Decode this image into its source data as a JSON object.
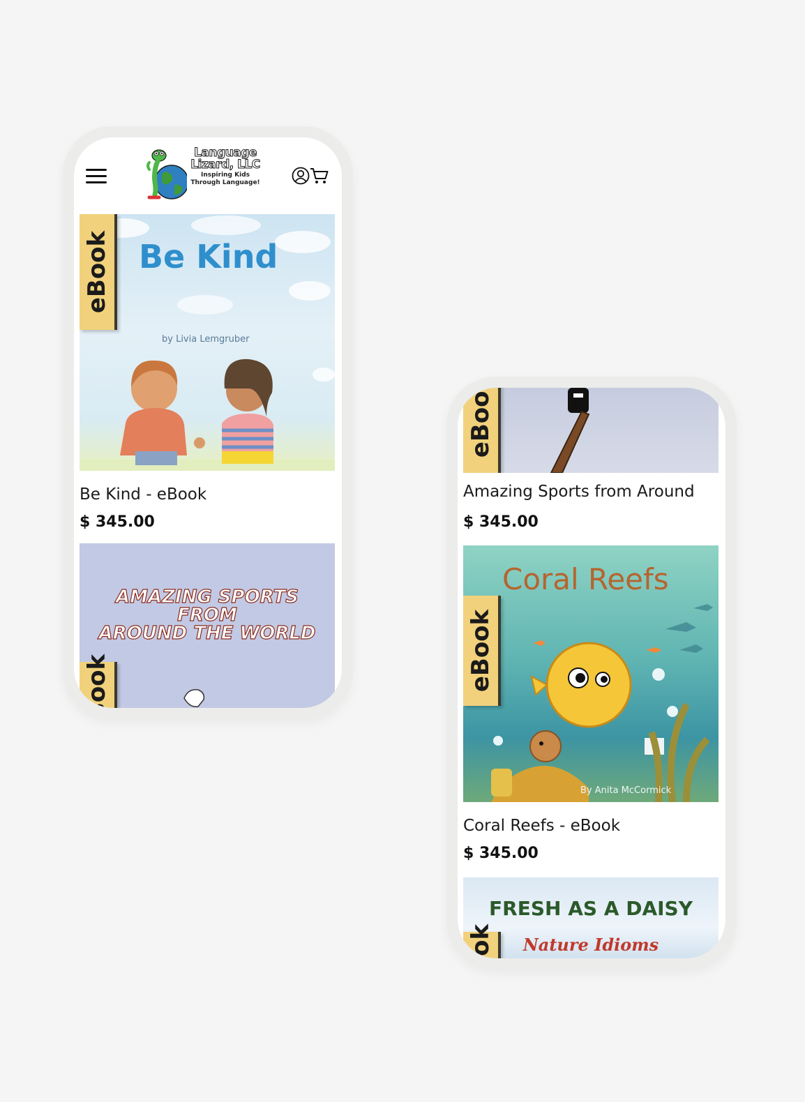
{
  "colors": {
    "background": "#f5f5f5",
    "ebook_tab": "#f1d17c",
    "be_kind_title": "#2f8fcd",
    "coral_title": "#b5652f",
    "daisy_title": "#2b5a2a",
    "daisy_subtitle": "#c0392b"
  },
  "header": {
    "menu_icon": "hamburger-icon",
    "logo": {
      "line1": "Language",
      "line2": "Lizard, LLC",
      "tagline1": "Inspiring Kids",
      "tagline2": "Through Language!"
    },
    "account_icon": "user-icon",
    "cart_icon": "cart-icon"
  },
  "phone1": {
    "products": [
      {
        "tab": "eBook",
        "cover_title": "Be Kind",
        "cover_author": "by Livia Lemgruber",
        "title": "Be Kind - eBook",
        "price": "$ 345.00"
      },
      {
        "tab": "eBook",
        "cover_line1": "AMAZING SPORTS",
        "cover_line2": "FROM",
        "cover_line3": "AROUND THE WORLD"
      }
    ]
  },
  "phone2": {
    "products": [
      {
        "tab": "eBook",
        "title": "Amazing Sports from Around",
        "price": "$ 345.00"
      },
      {
        "tab": "eBook",
        "cover_title": "Coral Reefs",
        "cover_author": "By Anita McCormick",
        "title": "Coral Reefs - eBook",
        "price": "$ 345.00"
      },
      {
        "tab": "eBook",
        "cover_title": "FRESH AS A DAISY",
        "cover_subtitle": "Nature Idioms"
      }
    ]
  }
}
